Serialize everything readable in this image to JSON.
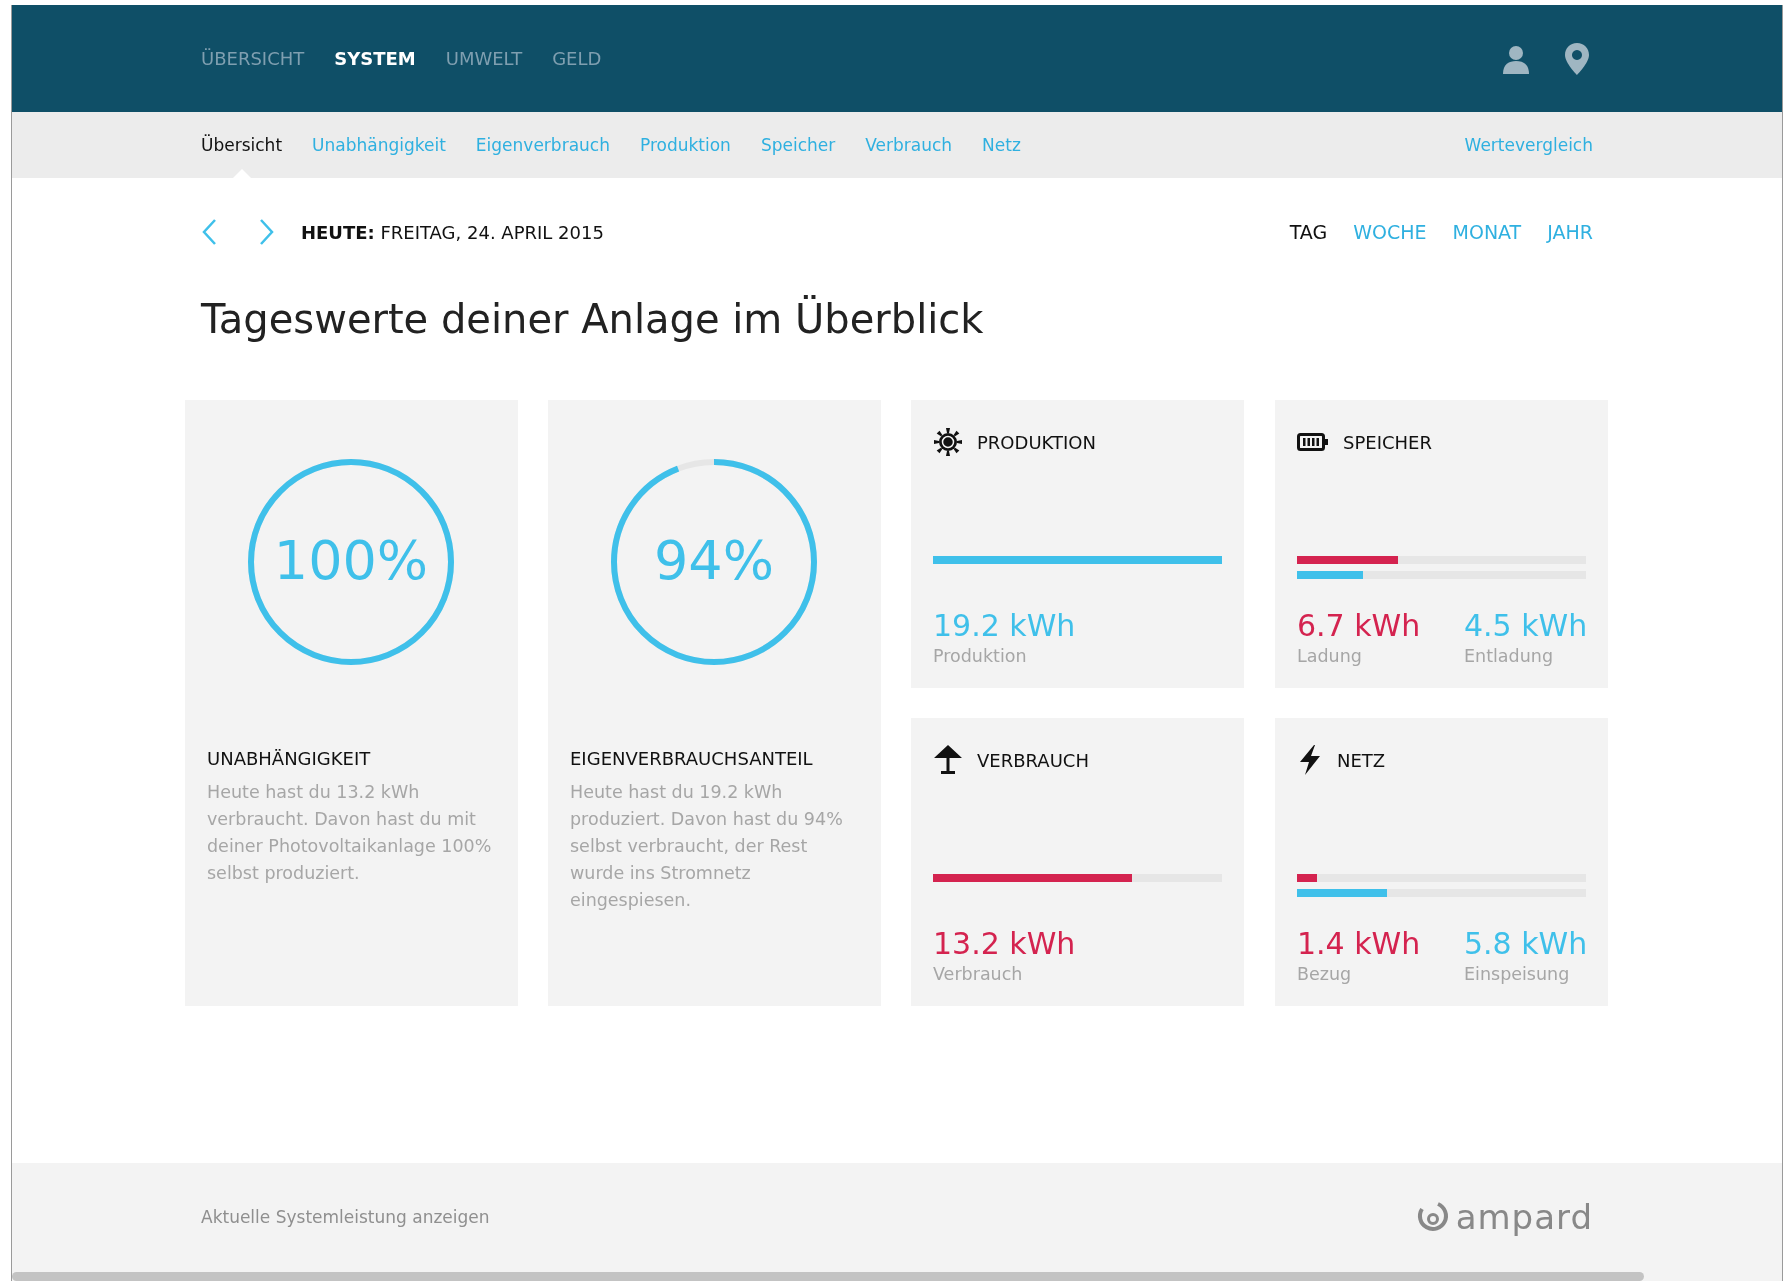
{
  "main_nav": [
    {
      "label": "ÜBERSICHT",
      "selected": false
    },
    {
      "label": "SYSTEM",
      "selected": true
    },
    {
      "label": "UMWELT",
      "selected": false
    },
    {
      "label": "GELD",
      "selected": false
    }
  ],
  "sub_nav": [
    {
      "label": "Übersicht",
      "selected": true
    },
    {
      "label": "Unabhängigkeit",
      "selected": false
    },
    {
      "label": "Eigenverbrauch",
      "selected": false
    },
    {
      "label": "Produktion",
      "selected": false
    },
    {
      "label": "Speicher",
      "selected": false
    },
    {
      "label": "Verbrauch",
      "selected": false
    },
    {
      "label": "Netz",
      "selected": false
    }
  ],
  "compare_link": "Wertevergleich",
  "date": "**HEUTE:** FREITAG, 24. APRIL 2015",
  "periods": [
    {
      "label": "TAG",
      "selected": true
    },
    {
      "label": "WOCHE",
      "selected": false
    },
    {
      "label": "MONAT",
      "selected": false
    },
    {
      "label": "JAHR",
      "selected": false
    }
  ],
  "heading": "Tageswerte deiner Anlage im Überblick",
  "ring_cards": [
    {
      "value": "100%",
      "level": 1.0,
      "title": "UNABHÄNGIGKEIT",
      "description": "Heute hast du 13.2 kWh verbraucht. Davon hast du mit deiner Photovoltaikanlage 100% selbst produziert."
    },
    {
      "value": "94%",
      "level": 0.94,
      "title": "EIGENVERBRAUCHSANTEIL",
      "description": "Heute hast du 19.2 kWh produziert. Davon hast du 94% selbst verbraucht, der Rest wurde ins Stromnetz eingespiesen."
    }
  ],
  "bar_cards": [
    {
      "title": "PRODUKTION",
      "bars": [
        {
          "level": 1.0,
          "color": "#3fc0ea"
        }
      ],
      "readings": [
        {
          "value": "19.2 kWh",
          "label": "Produktion",
          "color": "#3fc0ea"
        }
      ]
    },
    {
      "title": "SPEICHER",
      "bars": [
        {
          "level": 0.35,
          "color": "#d4234f"
        },
        {
          "level": 0.23,
          "color": "#3fc0ea"
        }
      ],
      "readings": [
        {
          "value": "6.7 kWh",
          "label": "Ladung",
          "color": "#d4234f"
        },
        {
          "value": "4.5 kWh",
          "label": "Entladung",
          "color": "#3fc0ea"
        }
      ]
    },
    {
      "title": "VERBRAUCH",
      "bars": [
        {
          "level": 0.69,
          "color": "#d4234f"
        }
      ],
      "readings": [
        {
          "value": "13.2 kWh",
          "label": "Verbrauch",
          "color": "#d4234f"
        }
      ]
    },
    {
      "title": "NETZ",
      "bars": [
        {
          "level": 0.07,
          "color": "#d4234f"
        },
        {
          "level": 0.31,
          "color": "#3fc0ea"
        }
      ],
      "readings": [
        {
          "value": "1.4 kWh",
          "label": "Bezug",
          "color": "#d4234f"
        },
        {
          "value": "5.8 kWh",
          "label": "Einspeisung",
          "color": "#3fc0ea"
        }
      ]
    }
  ],
  "footer": {
    "link": "Aktuelle Systemleistung anzeigen",
    "logo": "ampard"
  }
}
